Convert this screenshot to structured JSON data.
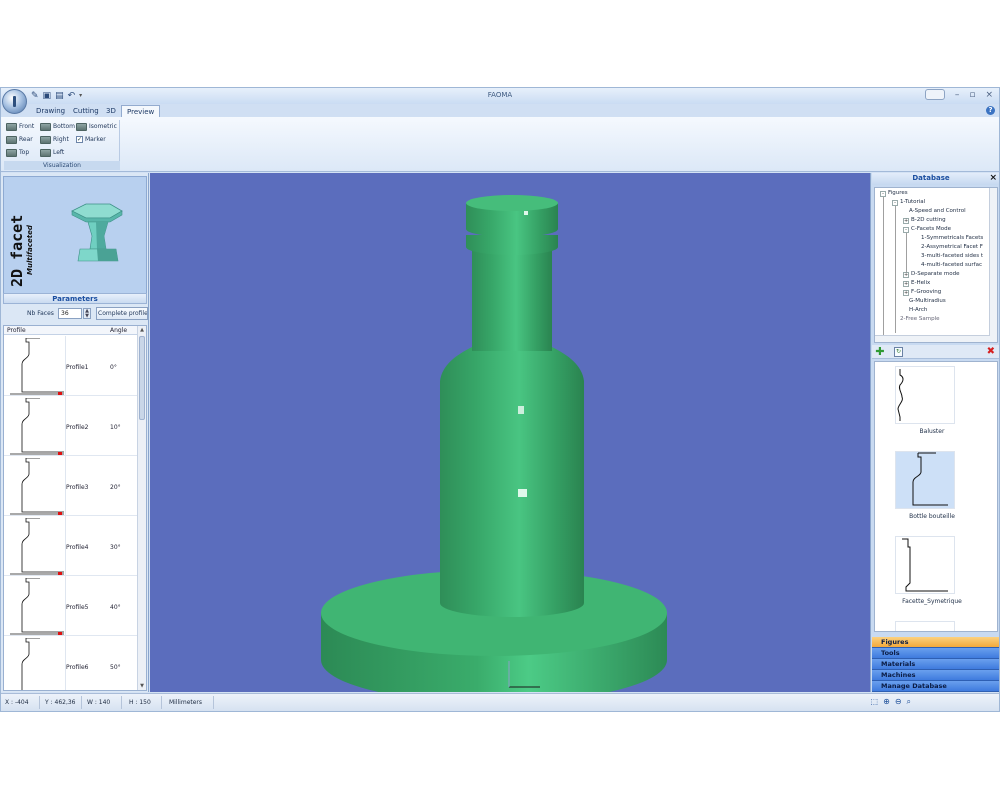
{
  "app": {
    "title": "FAOMA"
  },
  "quick_access": [
    "new-icon",
    "save-icon",
    "save-as-icon",
    "undo-icon"
  ],
  "ribbon": {
    "tabs": [
      "Drawing",
      "Cutting",
      "3D",
      "Preview"
    ],
    "active_tab": "Preview",
    "group_label": "Visualization",
    "buttons": {
      "front": "Front",
      "bottom": "Bottom",
      "isometric": "Isometric",
      "rear": "Rear",
      "right": "Right",
      "marker": "Marker",
      "top": "Top",
      "left": "Left"
    },
    "marker_checked": true
  },
  "left_panel": {
    "title": "2D facet",
    "subtitle": "Multifaceted",
    "params_header": "Parameters",
    "nb_faces_label": "Nb Faces",
    "nb_faces_value": "36",
    "complete_button": "Complete profile",
    "table_headers": {
      "profile": "Profile",
      "angle": "Angle"
    },
    "profiles": [
      {
        "name": "Profile1",
        "angle": "0°"
      },
      {
        "name": "Profile2",
        "angle": "10°"
      },
      {
        "name": "Profile3",
        "angle": "20°"
      },
      {
        "name": "Profile4",
        "angle": "30°"
      },
      {
        "name": "Profile5",
        "angle": "40°"
      },
      {
        "name": "Profile6",
        "angle": "50°"
      }
    ]
  },
  "viewport": {
    "background": "#5b6dbd",
    "model_color": "#34a869"
  },
  "database": {
    "title": "Database",
    "tree": {
      "root": "Figures",
      "tutorial": "1-Tutorial",
      "a": "A-Speed and Control",
      "b": "B-2D cutting",
      "c": "C-Facets Mode",
      "c1": "1-Symmetricals Facets",
      "c2": "2-Assymetrical Facet F",
      "c3": "3-multi-faceted sides t",
      "c4": "4-multi-faceted surfac",
      "d": "D-Separate mode",
      "e": "E-Helix",
      "f": "F-Grooving",
      "g": "G-Multiradius",
      "h": "H-Arch",
      "free": "2-Free Sample"
    },
    "figures": [
      {
        "label": "Baluster",
        "selected": false
      },
      {
        "label": "Bottle bouteille",
        "selected": true
      },
      {
        "label": "Facette_Symetrique",
        "selected": false
      }
    ],
    "nav_buttons": [
      "Figures",
      "Tools",
      "Materials",
      "Machines",
      "Manage Database"
    ],
    "active_nav": "Figures"
  },
  "status": {
    "x": "X : -404",
    "y": "Y : 462,36",
    "w": "W : 140",
    "h": "H : 150",
    "units": "Millimeters"
  }
}
